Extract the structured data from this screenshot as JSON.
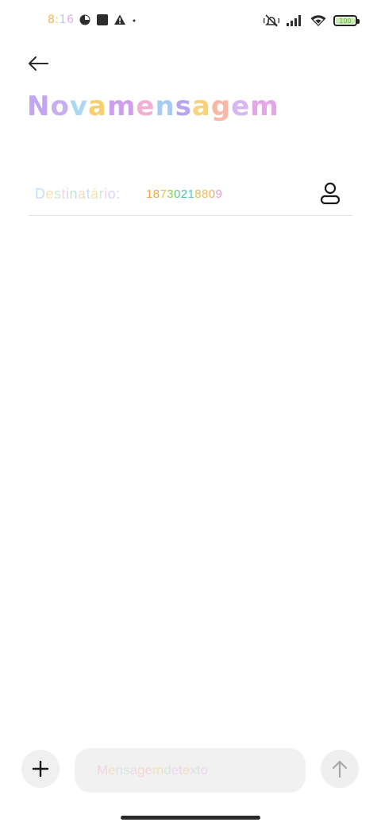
{
  "status_bar": {
    "time": "8:16",
    "battery": 100,
    "battery_label": "100",
    "icons": [
      "data-saver-icon",
      "app-square-icon",
      "warning-icon",
      "notification-dot-icon",
      "mute-vibrate-icon",
      "signal-icon",
      "wifi-icon",
      "battery-icon"
    ]
  },
  "header": {
    "back_icon": "arrow-left-icon",
    "title": "Nova mensagem"
  },
  "recipient": {
    "label": "Destinatário:",
    "value": "18730218809",
    "contact_icon": "person-icon"
  },
  "composer": {
    "add_icon": "plus-icon",
    "placeholder": "Mensagem de texto",
    "send_icon": "arrow-up-icon"
  },
  "colors": {
    "title_gradient": [
      "#c3a6ef",
      "#c6aeef",
      "#a9d9f2",
      "#f7cf6e",
      "#efb2dc",
      "#ce9ff0",
      "#f2b0d4",
      "#a8cbf4",
      "#b9a5ef",
      "#fad27b",
      "#f9b7a5",
      "#d6b7ef",
      "#e4a6e4"
    ],
    "recipient_digits": [
      "#f6a44b",
      "#f2a93f",
      "#e0c33f",
      "#9bc94a",
      "#63c77c",
      "#47c3a4",
      "#5fc9b8",
      "#d5c34d",
      "#f1bd52",
      "#f4a86d",
      "#e89ad7"
    ]
  }
}
